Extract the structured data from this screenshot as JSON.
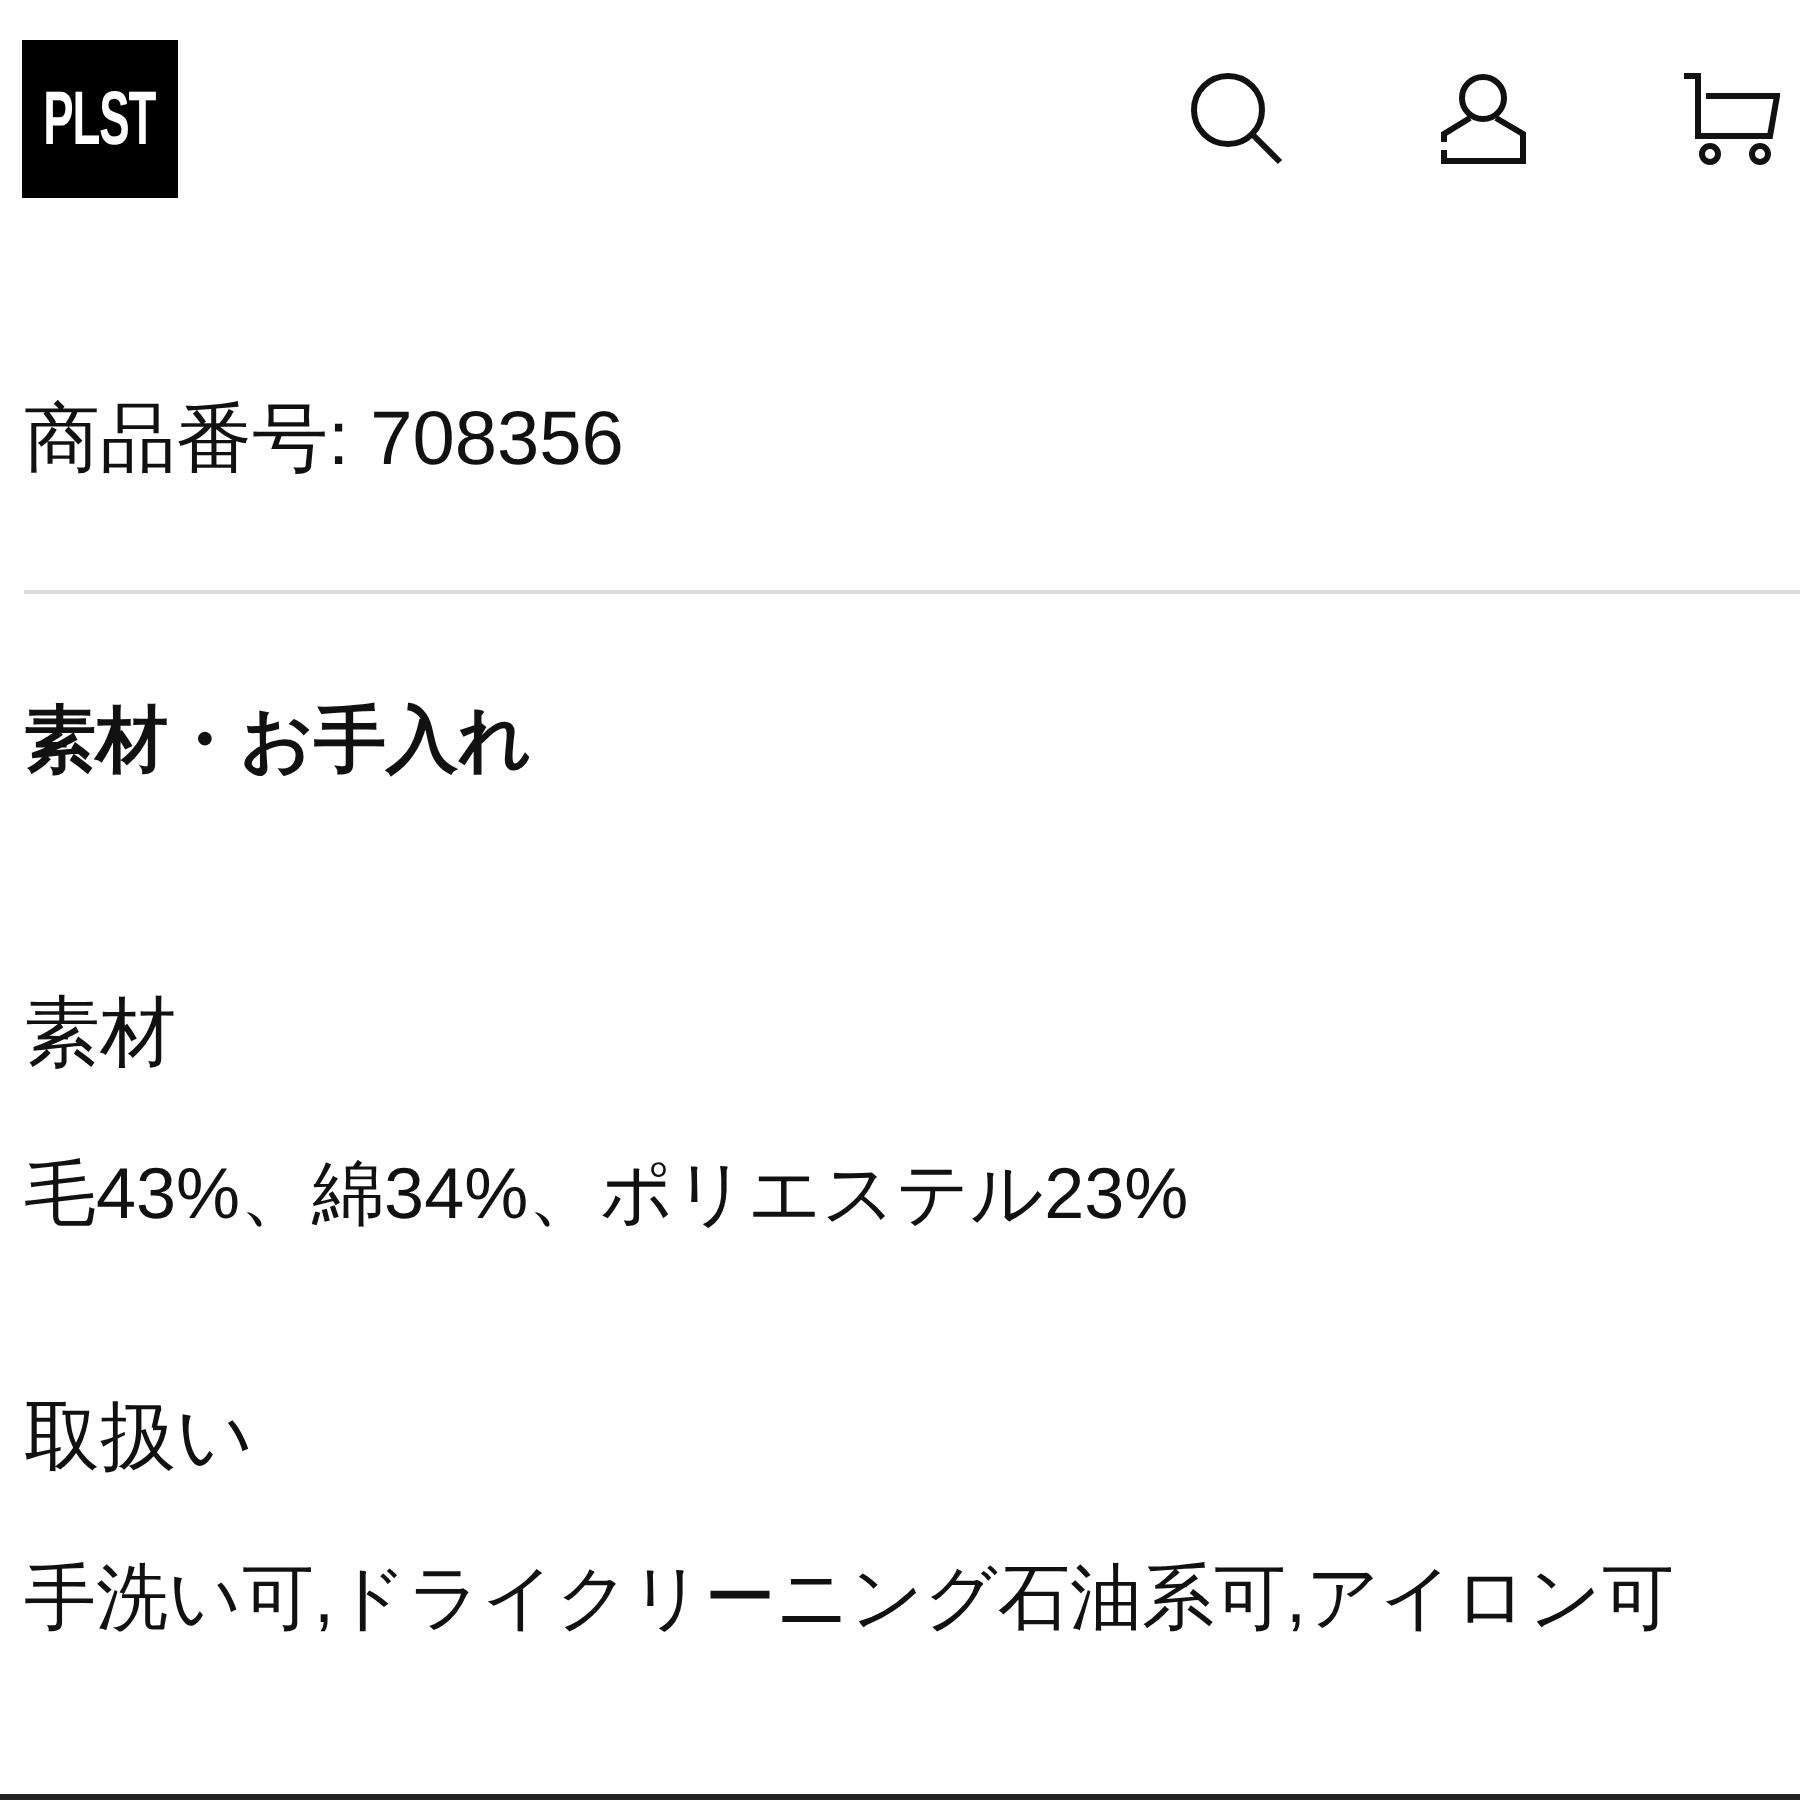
{
  "header": {
    "logo": "PLST"
  },
  "product_number": "商品番号: 708356",
  "section": {
    "title": "素材・お手入れ",
    "items": [
      {
        "label": "素材",
        "value": "毛43%、綿34%、ポリエステル23%"
      },
      {
        "label": "取扱い",
        "value": "手洗い可,ドライクリーニング石油系可,アイロン可"
      }
    ]
  }
}
